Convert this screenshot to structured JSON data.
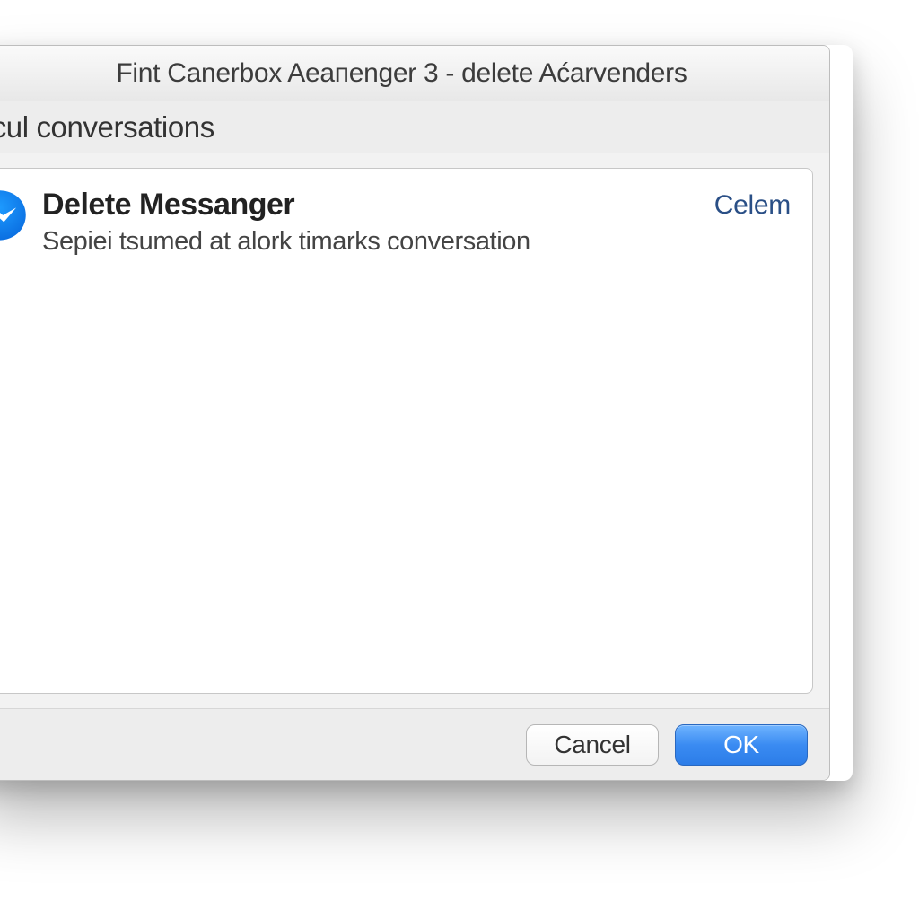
{
  "dialog": {
    "title": "Fint Canerbox Aeaпenger 3 - delete Aćarvenders",
    "section_header": "ticul conversations",
    "buttons": {
      "cancel": "Cancel",
      "ok": "OK"
    }
  },
  "items": [
    {
      "icon": "messenger-icon",
      "title": "Delete Messanger",
      "subtitle": "Sepiei tsumed at alork timarks conversation",
      "action": "Celem"
    }
  ],
  "colors": {
    "messenger_blue": "#0a7cff",
    "accent_link": "#2a4f86",
    "ok_button": "#3a8bf2"
  }
}
